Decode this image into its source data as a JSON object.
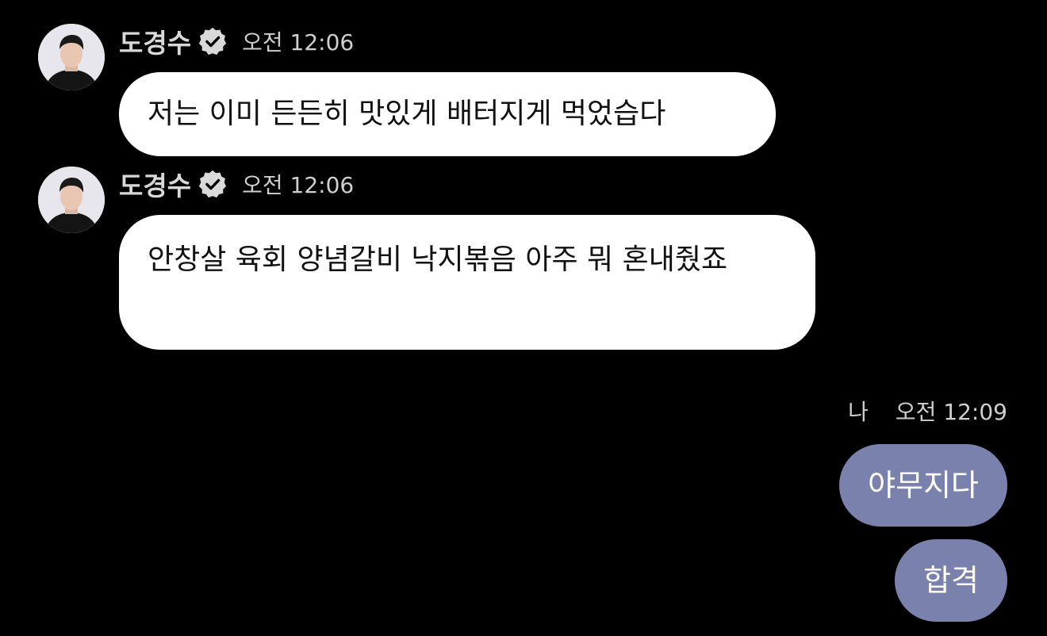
{
  "colors": {
    "background": "#000000",
    "incoming_bubble": "#ffffff",
    "outgoing_bubble": "#7b81ad",
    "meta_text": "#cfcfcf"
  },
  "messages": [
    {
      "sender": "도경수",
      "verified_icon": "verified-badge-icon",
      "time": "오전 12:06",
      "text": "저는 이미 든든히 맛있게 배터지게 먹었습다"
    },
    {
      "sender": "도경수",
      "verified_icon": "verified-badge-icon",
      "time": "오전 12:06",
      "text": "안창살 육회 양념갈비 낙지볶음 아주 뭐 혼내줬죠"
    }
  ],
  "my_messages": {
    "label": "나",
    "time": "오전 12:09",
    "items": [
      "야무지다",
      "합격"
    ]
  }
}
